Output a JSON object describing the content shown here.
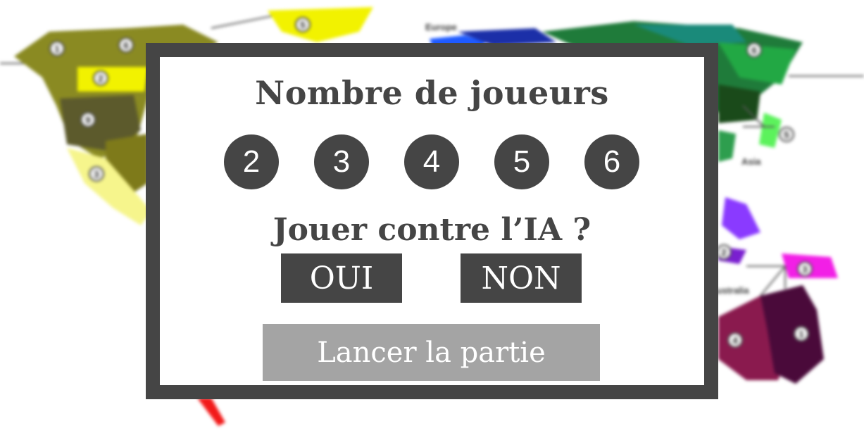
{
  "dialog": {
    "title": "Nombre de joueurs",
    "player_counts": [
      "2",
      "3",
      "4",
      "5",
      "6"
    ],
    "ai_question": "Jouer contre l’IA ?",
    "yes_label": "OUI",
    "no_label": "NON",
    "start_label": "Lancer la partie"
  },
  "map": {
    "continent_labels": {
      "europe": "Europe",
      "asia": "Asia",
      "australia": "Australia"
    },
    "territory_numbers": {
      "na_1": "1",
      "na_6": "6",
      "na_2": "2",
      "na_9": "9",
      "na_3": "3",
      "greenland_5": "5",
      "asia_6": "6",
      "asia_5": "5",
      "oc_2": "2",
      "oc_3": "3",
      "oc_4": "4",
      "oc_1": "1"
    }
  },
  "colors": {
    "dialog_frame": "#454545",
    "button_dark": "#454545",
    "button_start": "#a4a4a4",
    "text_light": "#ffffff"
  }
}
